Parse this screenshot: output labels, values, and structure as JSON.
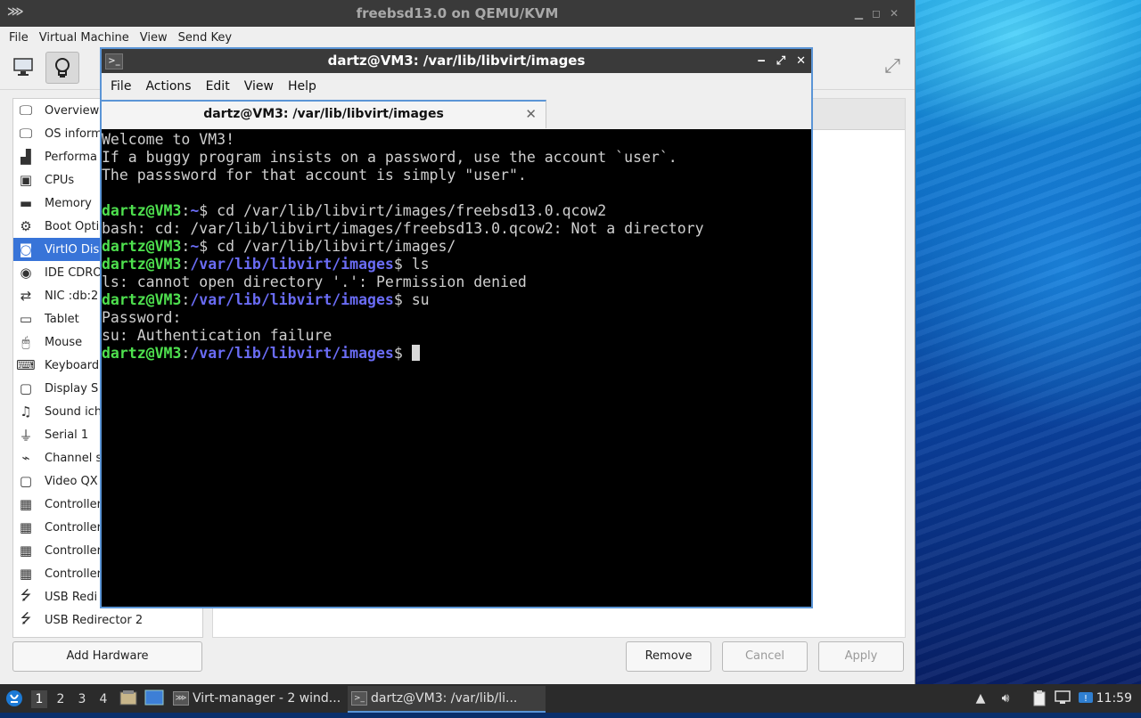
{
  "vm_window": {
    "title": "freebsd13.0 on QEMU/KVM",
    "menu": [
      "File",
      "Virtual Machine",
      "View",
      "Send Key"
    ],
    "hardware": [
      {
        "label": "Overview",
        "icon": "monitor-icon"
      },
      {
        "label": "OS inform",
        "icon": "monitor-icon"
      },
      {
        "label": "Performa",
        "icon": "performance-graph-icon"
      },
      {
        "label": "CPUs",
        "icon": "cpu-chip-icon"
      },
      {
        "label": "Memory",
        "icon": "memory-module-icon"
      },
      {
        "label": "Boot Opti",
        "icon": "gears-icon"
      },
      {
        "label": "VirtIO Dis",
        "icon": "disk-icon",
        "selected": true
      },
      {
        "label": "IDE CDRO",
        "icon": "cdrom-icon"
      },
      {
        "label": "NIC :db:2",
        "icon": "network-arrows-icon"
      },
      {
        "label": "Tablet",
        "icon": "tablet-icon"
      },
      {
        "label": "Mouse",
        "icon": "mouse-icon"
      },
      {
        "label": "Keyboard",
        "icon": "keyboard-icon"
      },
      {
        "label": "Display S",
        "icon": "display-icon"
      },
      {
        "label": "Sound ich",
        "icon": "sound-icon"
      },
      {
        "label": "Serial 1",
        "icon": "serial-port-icon"
      },
      {
        "label": "Channel s",
        "icon": "channel-icon"
      },
      {
        "label": "Video QX",
        "icon": "video-icon"
      },
      {
        "label": "Controller",
        "icon": "controller-card-icon"
      },
      {
        "label": "Controller",
        "icon": "controller-card-icon"
      },
      {
        "label": "Controller",
        "icon": "controller-card-icon"
      },
      {
        "label": "Controller",
        "icon": "controller-card-icon"
      },
      {
        "label": "USB Redi",
        "icon": "usb-icon"
      },
      {
        "label": "USB Redirector 2",
        "icon": "usb-icon"
      }
    ],
    "buttons": {
      "add_hardware": "Add Hardware",
      "remove": "Remove",
      "cancel": "Cancel",
      "apply": "Apply"
    }
  },
  "terminal": {
    "title": "dartz@VM3: /var/lib/libvirt/images",
    "menu": [
      "File",
      "Actions",
      "Edit",
      "View",
      "Help"
    ],
    "tab_label": "dartz@VM3: /var/lib/libvirt/images",
    "lines": [
      {
        "text": "Welcome to VM3!"
      },
      {
        "text": "If a buggy program insists on a password, use the account `user`."
      },
      {
        "text": "The passsword for that account is simply \"user\"."
      },
      {
        "text": ""
      },
      {
        "user": "dartz@VM3",
        "path": "~",
        "cmd": "cd /var/lib/libvirt/images/freebsd13.0.qcow2"
      },
      {
        "text": "bash: cd: /var/lib/libvirt/images/freebsd13.0.qcow2: Not a directory"
      },
      {
        "user": "dartz@VM3",
        "path": "~",
        "cmd": "cd /var/lib/libvirt/images/"
      },
      {
        "user": "dartz@VM3",
        "path": "/var/lib/libvirt/images",
        "cmd": "ls"
      },
      {
        "text": "ls: cannot open directory '.': Permission denied"
      },
      {
        "user": "dartz@VM3",
        "path": "/var/lib/libvirt/images",
        "cmd": "su"
      },
      {
        "text": "Password:"
      },
      {
        "text": "su: Authentication failure"
      },
      {
        "user": "dartz@VM3",
        "path": "/var/lib/libvirt/images",
        "cmd": "",
        "cursor": true
      }
    ]
  },
  "taskbar": {
    "workspaces": [
      "1",
      "2",
      "3",
      "4"
    ],
    "tasks": [
      {
        "label": "Virt-manager - 2 wind...",
        "active": false
      },
      {
        "label": "dartz@VM3: /var/lib/li...",
        "active": true
      }
    ],
    "clock": "11:59"
  },
  "colors": {
    "selection": "#3874d8",
    "prompt_user": "#4ee04e",
    "prompt_path": "#6a6cf5",
    "terminal_bg": "#000000",
    "titlebar": "#3a3a3a"
  }
}
